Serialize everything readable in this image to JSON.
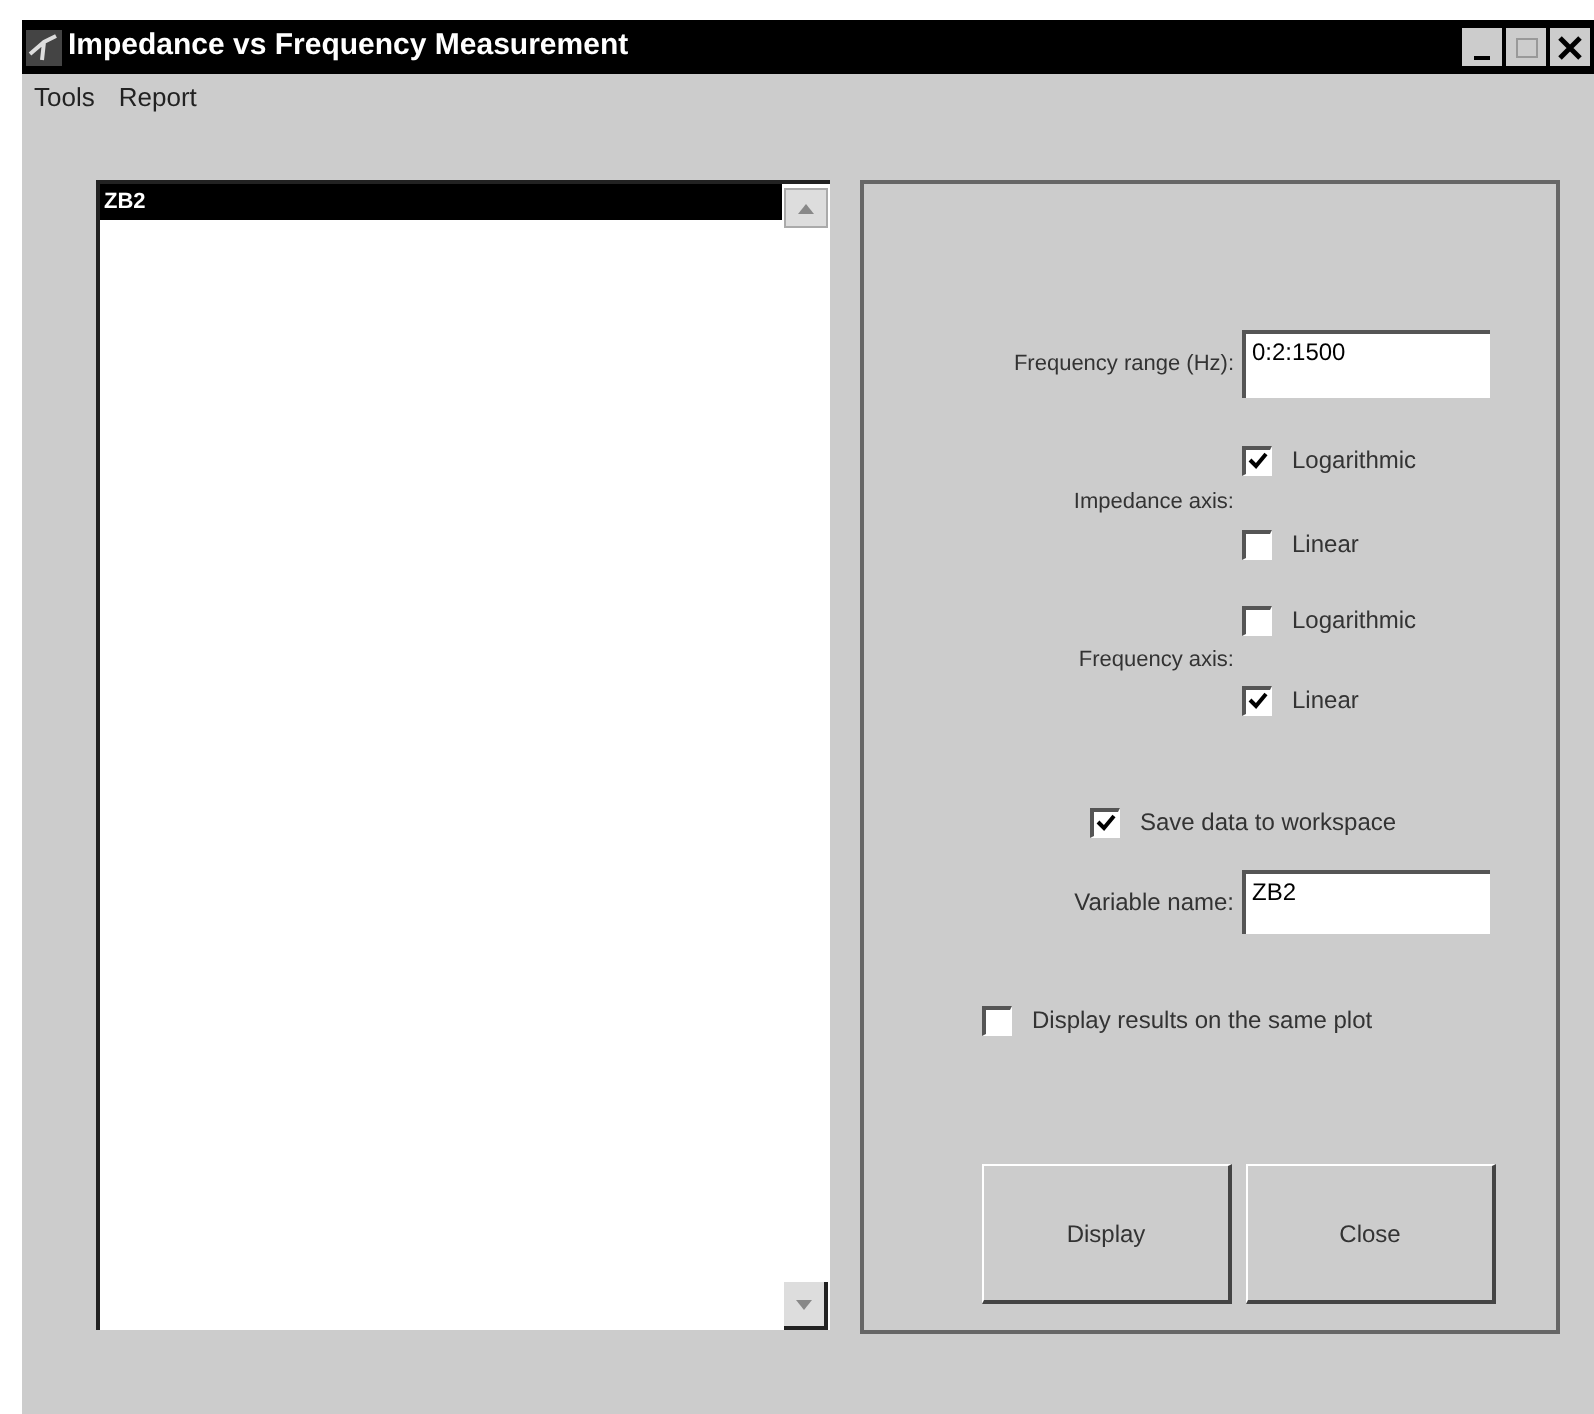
{
  "window": {
    "title": "Impedance vs Frequency Measurement"
  },
  "menu": [
    "Tools",
    "Report"
  ],
  "list": {
    "items": [
      {
        "label": "ZB2",
        "selected": true
      }
    ]
  },
  "frequency_range": {
    "label": "Frequency range (Hz):",
    "value": "0:2:1500"
  },
  "axes": [
    {
      "label": "Impedance axis:",
      "options": [
        {
          "label": "Logarithmic",
          "checked": true
        },
        {
          "label": "Linear",
          "checked": false
        }
      ]
    },
    {
      "label": "Frequency axis:",
      "options": [
        {
          "label": "Logarithmic",
          "checked": false
        },
        {
          "label": "Linear",
          "checked": true
        }
      ]
    }
  ],
  "save_data": {
    "label": "Save data to workspace",
    "checked": true
  },
  "variable_name": {
    "label": "Variable name:",
    "value": "ZB2"
  },
  "same_plot": {
    "label": "Display results on the same plot",
    "checked": false
  },
  "buttons": [
    "Display",
    "Close"
  ]
}
